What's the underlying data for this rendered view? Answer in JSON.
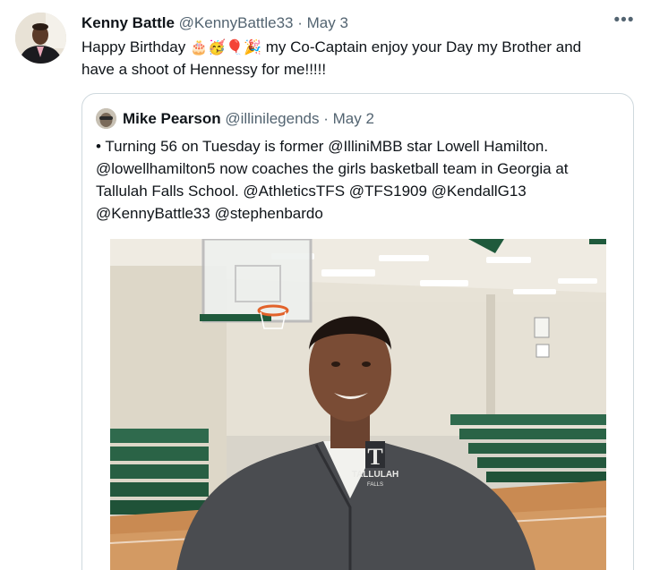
{
  "tweet": {
    "author_name": "Kenny Battle",
    "author_handle": "@KennyBattle33",
    "separator": "·",
    "date": "May 3",
    "more_glyph": "•••",
    "text_part1": "Happy Birthday",
    "emojis": [
      "🎂",
      "🥳",
      "🎈",
      "🎉"
    ],
    "text_part2": "my Co-Captain enjoy your Day my Brother and",
    "text_line2": "have a shoot of Hennessy for me!!!!!"
  },
  "quoted": {
    "author_name": "Mike Pearson",
    "author_handle": "@illinilegends",
    "separator": "·",
    "date": "May 2",
    "lines": [
      "• Turning 56 on Tuesday is former @IlliniMBB star Lowell Hamilton.",
      "@lowellhamilton5 now coaches the girls basketball team in Georgia at",
      "Tallulah Falls School. @AthleticsTFS  @TFS1909  @KendallG13",
      "@KennyBattle33 @stephenbardo"
    ],
    "photo": {
      "shirt_logo_letter": "T",
      "shirt_logo_text": "TALLULAH",
      "shirt_logo_subtext": "FALLS"
    }
  },
  "colors": {
    "text_primary": "#0f1419",
    "text_secondary": "#536471",
    "border": "#cfd9de",
    "gym_green": "#1f5a3c"
  }
}
